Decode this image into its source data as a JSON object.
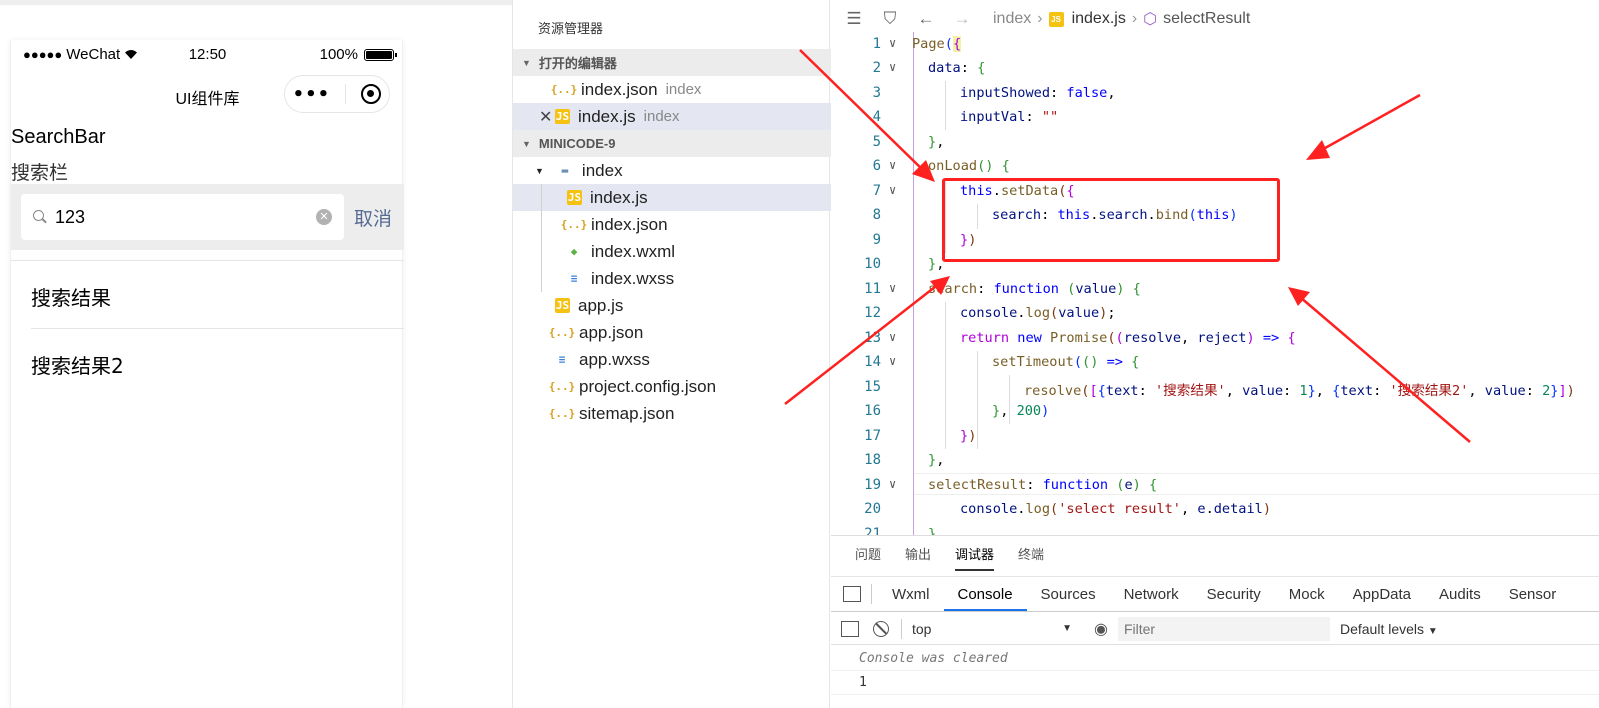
{
  "simulator": {
    "status": {
      "carrier": "WeChat",
      "time": "12:50",
      "battery": "100%"
    },
    "nav_title": "UI组件库",
    "heading": "SearchBar",
    "subheading": "搜索栏",
    "search": {
      "value": "123",
      "cancel_label": "取消"
    },
    "results": [
      "搜索结果",
      "搜索结果2"
    ]
  },
  "explorer": {
    "title": "资源管理器",
    "open_editors_label": "打开的编辑器",
    "open_editors": [
      {
        "name": "index.json",
        "hint": "index"
      },
      {
        "name": "index.js",
        "hint": "index"
      }
    ],
    "project_label": "MINICODE-9",
    "folder": "index",
    "folder_files": [
      "index.js",
      "index.json",
      "index.wxml",
      "index.wxss"
    ],
    "root_files": [
      "app.js",
      "app.json",
      "app.wxss",
      "project.config.json",
      "sitemap.json"
    ]
  },
  "editor": {
    "breadcrumb": {
      "folder": "index",
      "file": "index.js",
      "symbol": "selectResult"
    },
    "line_numbers": [
      "1",
      "2",
      "3",
      "4",
      "5",
      "6",
      "7",
      "8",
      "9",
      "10",
      "11",
      "12",
      "13",
      "14",
      "15",
      "16",
      "17",
      "18",
      "19",
      "20",
      "21"
    ]
  },
  "debug": {
    "tabs": [
      "问题",
      "输出",
      "调试器",
      "终端"
    ],
    "active_tab": "调试器",
    "devtools_tabs": [
      "Wxml",
      "Console",
      "Sources",
      "Network",
      "Security",
      "Mock",
      "AppData",
      "Audits",
      "Sensor"
    ],
    "active_devtools_tab": "Console",
    "context": "top",
    "filter_placeholder": "Filter",
    "levels": "Default levels",
    "console_lines": [
      "Console was cleared",
      "1"
    ]
  },
  "colors": {
    "annotation": "#ff2020",
    "accent_blue": "#1a73e8",
    "link_blue": "#576b95"
  }
}
